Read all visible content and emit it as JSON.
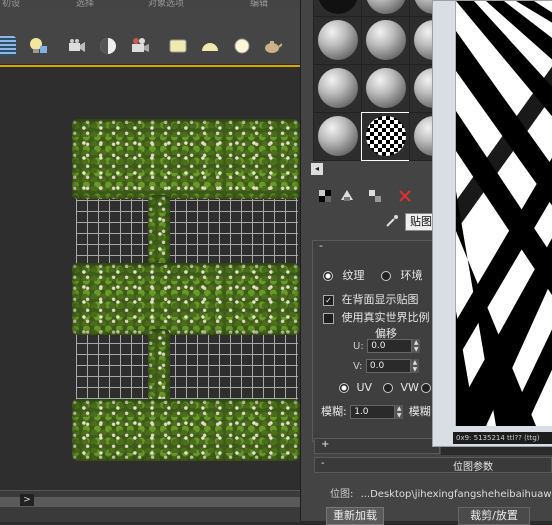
{
  "menubar": {
    "items": [
      "初设",
      "选择",
      "对象选项",
      "编辑"
    ]
  },
  "toolbar": {
    "icons": [
      "list-icon",
      "light-bulb-icon",
      "camera-icon",
      "sphere-half-icon",
      "video-camera-icon",
      "rectangle-light-icon",
      "dome-light-icon",
      "sphere-light-icon",
      "teapot-icon"
    ]
  },
  "material_slots": {
    "checker_slot_index": 7
  },
  "material_toolbar": {
    "tab_label": "贴图"
  },
  "coordinates": {
    "rollout_title": "-",
    "texture_label": "纹理",
    "environ_label": "环境",
    "show_map_on_back_label": "在背面显示贴图",
    "show_map_on_back_checked": true,
    "real_world_label": "使用真实世界比例",
    "real_world_checked": false,
    "offset_label": "偏移",
    "u_label": "U:",
    "u_value": "0.0",
    "v_label": "V:",
    "v_value": "0.0",
    "uv_label": "UV",
    "vw_label": "VW",
    "blur_label": "模糊:",
    "blur_value": "1.0",
    "blur_offset_label": "模糊"
  },
  "noise_rollout": {
    "title": "+"
  },
  "bitmap_params": {
    "collapse": "-",
    "title": "位图参数",
    "bitmap_label": "位图:",
    "bitmap_path": "...Desktop\\jihexingfangsheheibaihuawe",
    "reload_label": "重新加载",
    "crop_label": "裁剪/放置"
  },
  "preview": {
    "status_text": "0x9: 5135214  ttl?? (ttg)"
  },
  "timeline": {
    "next_label": ">"
  }
}
